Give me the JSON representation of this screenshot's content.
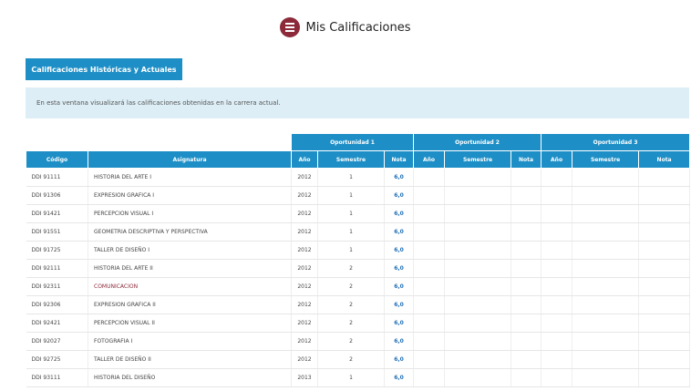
{
  "header": {
    "title": "Mis Calificaciones",
    "icon": "list-icon",
    "icon_color": "#8c2a3a"
  },
  "tab": {
    "label": "Calificaciones Históricas y Actuales"
  },
  "info": {
    "text": "En esta ventana visualizará las calificaciones obtenidas en la carrera actual."
  },
  "table": {
    "group_headers": [
      "Oportunidad 1",
      "Oportunidad 2",
      "Oportunidad 3"
    ],
    "columns": [
      "Código",
      "Asignatura",
      "Año",
      "Semestre",
      "Nota",
      "Año",
      "Semestre",
      "Nota",
      "Año",
      "Semestre",
      "Nota"
    ],
    "rows": [
      {
        "code": "DDI 91111",
        "subject": "HISTORIA DEL ARTE I",
        "year": "2012",
        "semester": "1",
        "grade": "6,0"
      },
      {
        "code": "DDI 91306",
        "subject": "EXPRESION GRAFICA I",
        "year": "2012",
        "semester": "1",
        "grade": "6,0"
      },
      {
        "code": "DDI 91421",
        "subject": "PERCEPCION VISUAL I",
        "year": "2012",
        "semester": "1",
        "grade": "6,0"
      },
      {
        "code": "DDI 91551",
        "subject": "GEOMETRIA DESCRIPTIVA Y PERSPECTIVA",
        "year": "2012",
        "semester": "1",
        "grade": "6,0"
      },
      {
        "code": "DDI 91725",
        "subject": "TALLER DE DISEÑO I",
        "year": "2012",
        "semester": "1",
        "grade": "6,0"
      },
      {
        "code": "DDI 92111",
        "subject": "HISTORIA DEL ARTE II",
        "year": "2012",
        "semester": "2",
        "grade": "6,0"
      },
      {
        "code": "DDI 92311",
        "subject": "COMUNICACION",
        "year": "2012",
        "semester": "2",
        "grade": "6,0"
      },
      {
        "code": "DDI 92306",
        "subject": "EXPRESION GRAFICA II",
        "year": "2012",
        "semester": "2",
        "grade": "6,0"
      },
      {
        "code": "DDI 92421",
        "subject": "PERCEPCION VISUAL II",
        "year": "2012",
        "semester": "2",
        "grade": "6,0"
      },
      {
        "code": "DDI 92027",
        "subject": "FOTOGRAFIA I",
        "year": "2012",
        "semester": "2",
        "grade": "6,0"
      },
      {
        "code": "DDI 92725",
        "subject": "TALLER DE DISEÑO II",
        "year": "2012",
        "semester": "2",
        "grade": "6,0"
      },
      {
        "code": "DDI 93111",
        "subject": "HISTORIA DEL DISEÑO",
        "year": "2013",
        "semester": "1",
        "grade": "6,0"
      }
    ]
  },
  "colors": {
    "accent": "#1e8fc6",
    "info_bg": "#ddeef6",
    "grade": "#1e6fb8"
  }
}
